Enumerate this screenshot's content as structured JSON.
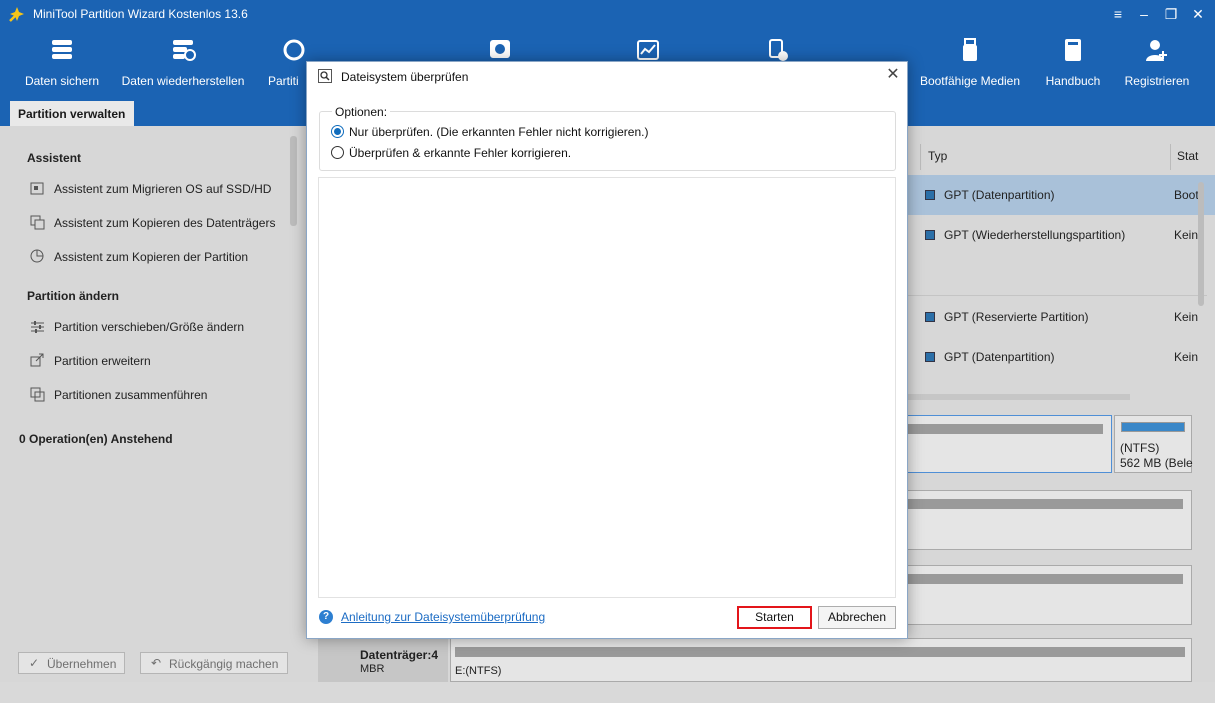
{
  "app": {
    "title": "MiniTool Partition Wizard Kostenlos 13.6"
  },
  "toolbar": {
    "items": [
      {
        "label": "Daten sichern",
        "icon": "backup-icon"
      },
      {
        "label": "Daten wiederherstellen",
        "icon": "data-recovery-icon"
      },
      {
        "label": "Partiti",
        "icon": "partition-recovery-icon"
      },
      {
        "label": "",
        "icon": "disk-benchmark-icon"
      },
      {
        "label": "",
        "icon": "space-analyzer-icon"
      },
      {
        "label": "",
        "icon": "migrate-icon"
      },
      {
        "label": "Bootfähige Medien",
        "icon": "bootable-media-icon"
      },
      {
        "label": "Handbuch",
        "icon": "manual-icon"
      },
      {
        "label": "Registrieren",
        "icon": "register-icon"
      }
    ]
  },
  "tab": {
    "label": "Partition verwalten"
  },
  "sidebar": {
    "wizard_title": "Assistent",
    "wizard_items": [
      "Assistent zum Migrieren OS auf SSD/HD",
      "Assistent zum Kopieren des Datenträgers",
      "Assistent zum Kopieren der Partition"
    ],
    "change_title": "Partition ändern",
    "change_items": [
      "Partition verschieben/Größe ändern",
      "Partition erweitern",
      "Partitionen zusammenführen"
    ],
    "pending": "0 Operation(en) Anstehend",
    "apply_label": "Übernehmen",
    "undo_label": "Rückgängig machen"
  },
  "table": {
    "col_type": "Typ",
    "col_status": "Stat",
    "rows": [
      {
        "type": "GPT (Datenpartition)",
        "status": "Boot",
        "selected": true
      },
      {
        "type": "GPT (Wiederherstellungspartition)",
        "status": "Kein",
        "selected": false
      },
      {
        "type": "GPT (Reservierte Partition)",
        "status": "Kein",
        "selected": false
      },
      {
        "type": "GPT (Datenpartition)",
        "status": "Kein",
        "selected": false
      }
    ]
  },
  "diskmap": {
    "part_fs": "(NTFS)",
    "part_size": "562 MB (Bele",
    "disk4_name": "Datenträger:4",
    "disk4_type": "MBR",
    "disk4_part": "E:(NTFS)"
  },
  "dialog": {
    "title": "Dateisystem überprüfen",
    "options_legend": "Optionen:",
    "option_check_only": "Nur überprüfen. (Die erkannten Fehler nicht korrigieren.)",
    "option_check_fix": "Überprüfen & erkannte Fehler korrigieren.",
    "selected_option": "check_only",
    "help_link": "Anleitung zur Dateisystemüberprüfung",
    "start_label": "Starten",
    "cancel_label": "Abbrechen"
  },
  "colors": {
    "accent": "#1b63b3",
    "highlight": "#e3151a",
    "selected_row": "#a9c1d9"
  }
}
